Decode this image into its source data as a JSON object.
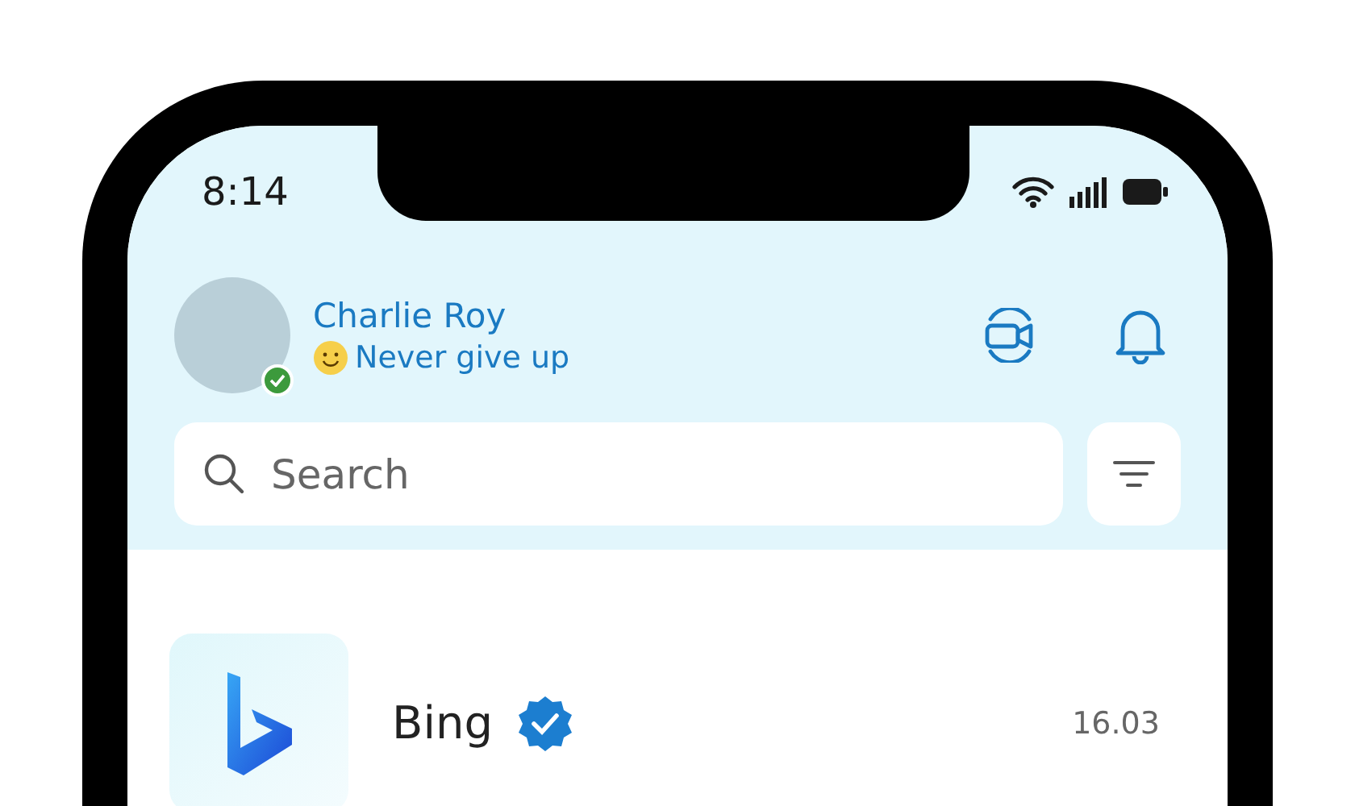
{
  "status_bar": {
    "time": "8:14"
  },
  "profile": {
    "name": "Charlie Roy",
    "status": "Never give up",
    "online": true
  },
  "search": {
    "placeholder": "Search"
  },
  "chats": [
    {
      "name": "Bing",
      "verified": true,
      "time": "16.03"
    }
  ]
}
